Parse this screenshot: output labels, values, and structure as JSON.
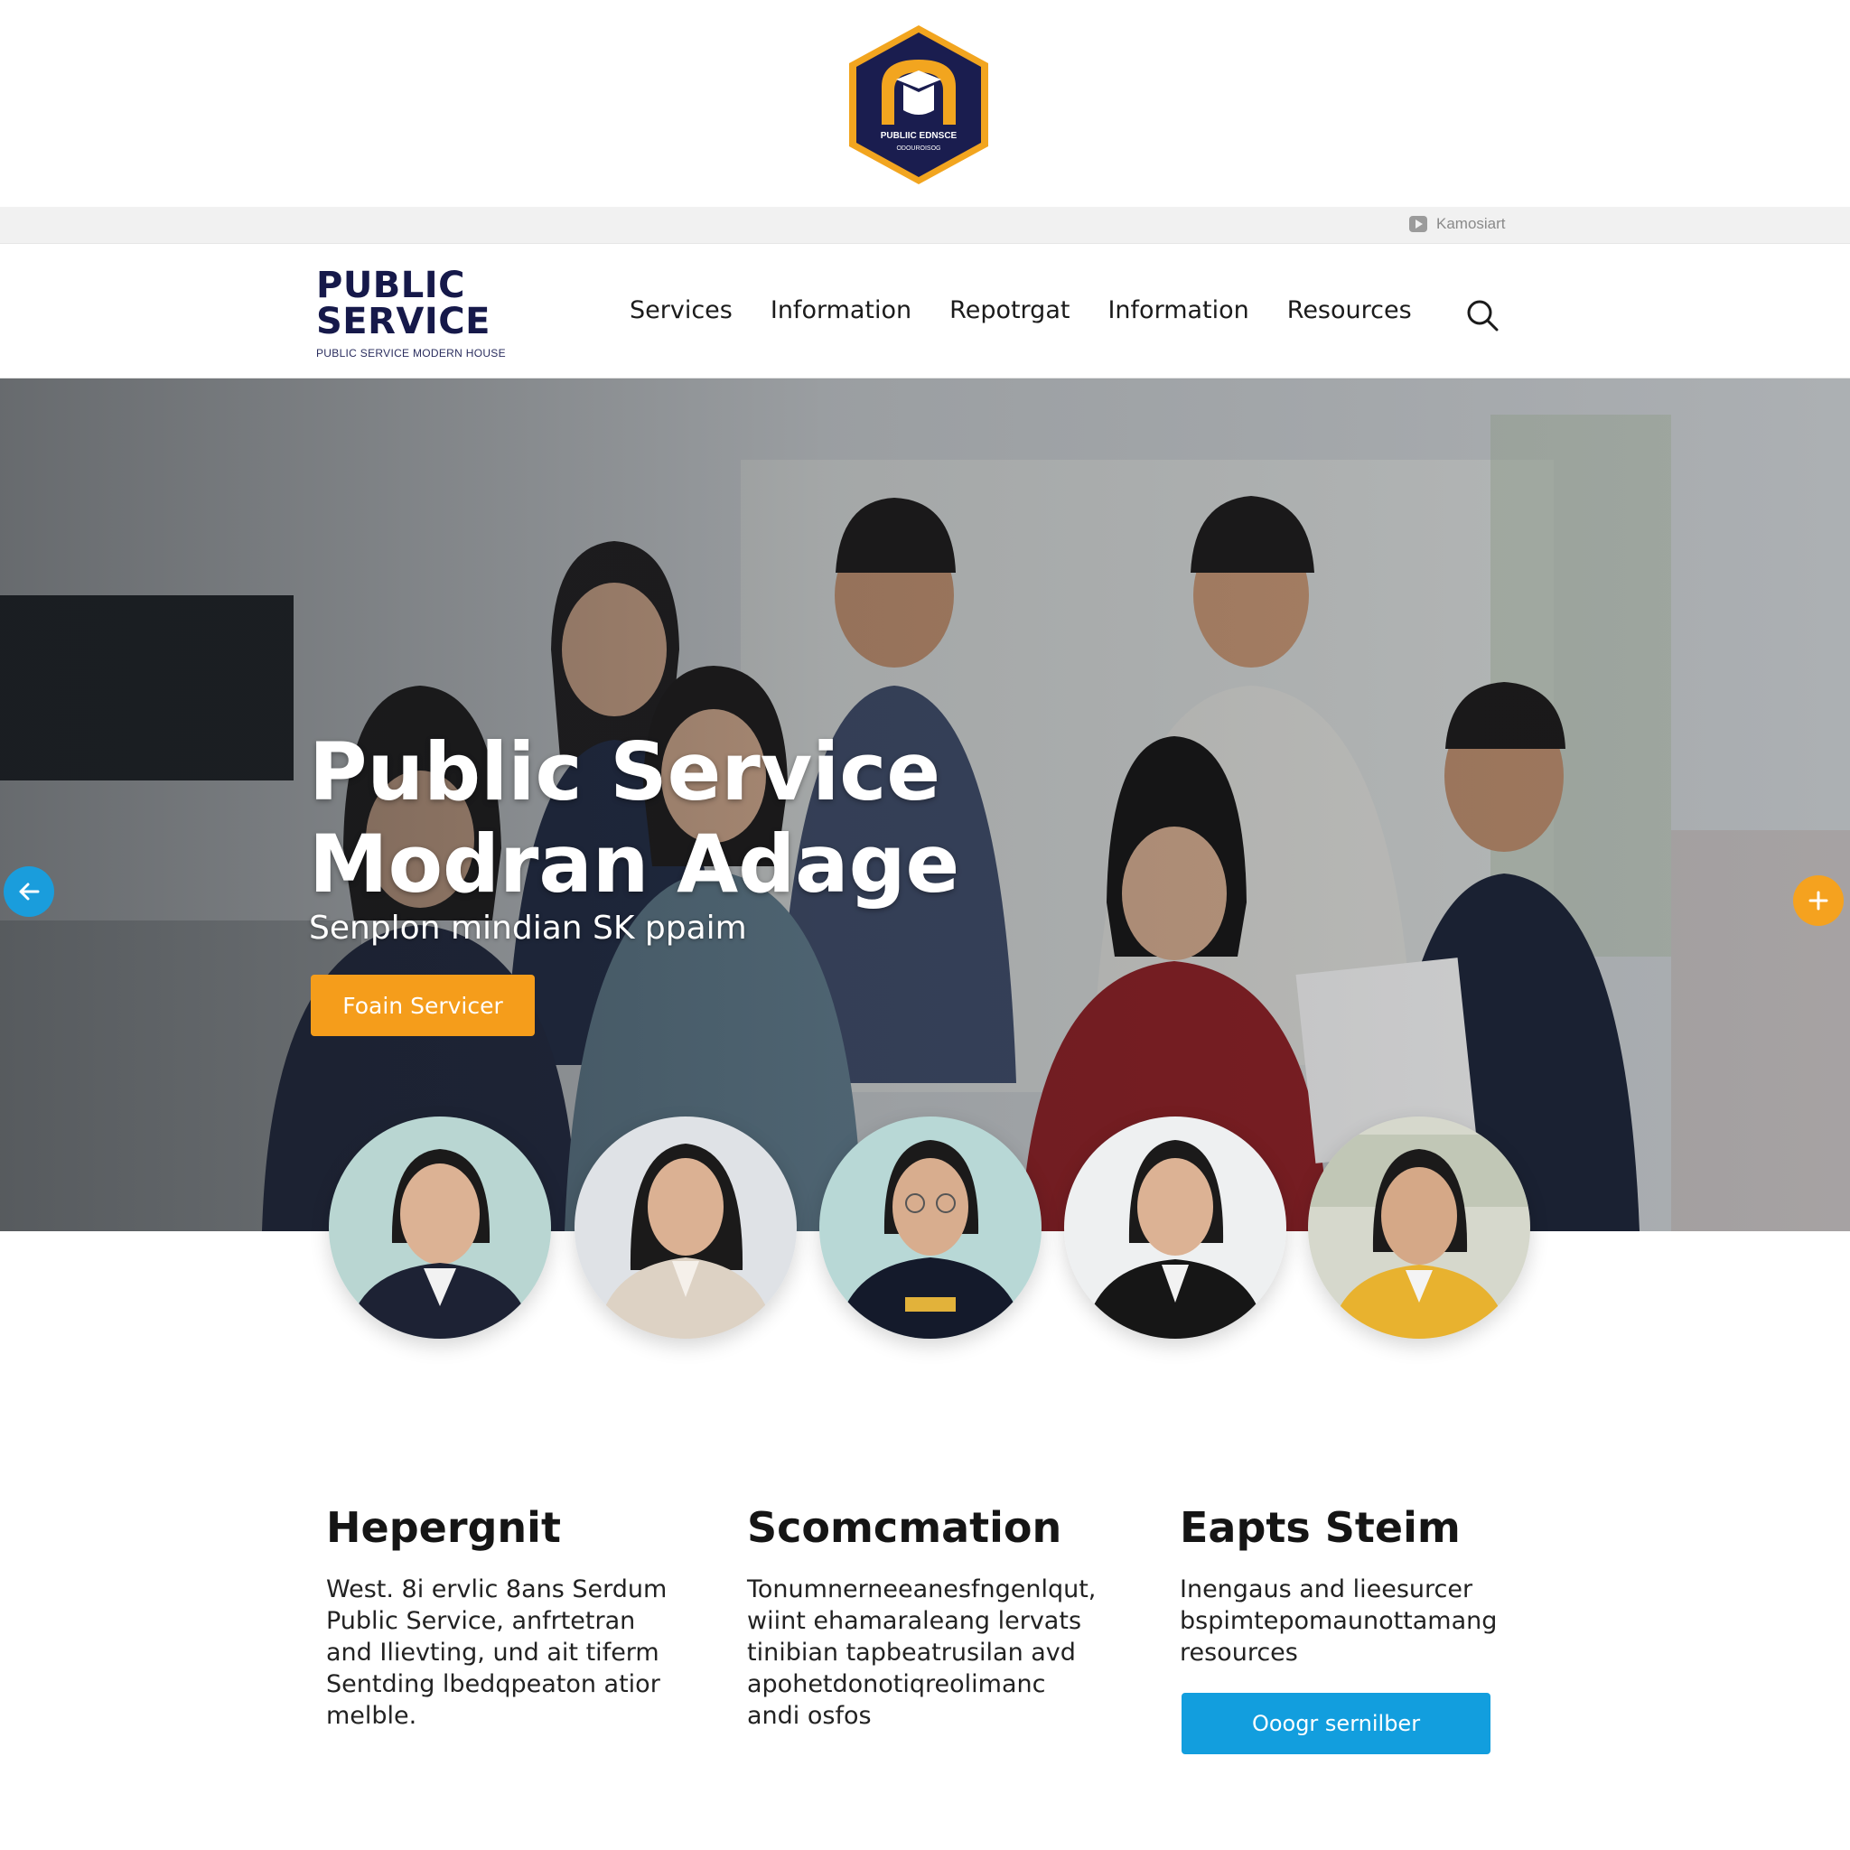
{
  "emblem": {
    "text_top": "PUBLIIC EDNSCE",
    "text_bottom": "ODOUROISOG"
  },
  "utility_bar": {
    "link_label": "Kamosiart"
  },
  "brand": {
    "line1": "PUBLIC",
    "line2": "SERVICE",
    "tagline": "PUBLIC SERVICE MODERN HOUSE"
  },
  "nav": {
    "items": [
      "Services",
      "Information",
      "Repotrgat",
      "Information",
      "Resources"
    ]
  },
  "hero": {
    "title_line1": "Public Service",
    "title_line2": "Modran Adage",
    "subtitle": "Senplon mindian SK ppaim",
    "cta_label": "Foain Servicer"
  },
  "features": [
    {
      "title": "Hepergnit",
      "lines": [
        "West. 8i ervlic 8ans Serdum",
        "Public Service, anfrtetran",
        "and Ilievting, und ait tiferm",
        "Sentding lbedqpeaton atior",
        "melble."
      ]
    },
    {
      "title": "Scomcmation",
      "lines": [
        "Tonumnerneeanesfngenlqut,",
        "wiint ehamaraleang lervats",
        "tinibian tapbeatrusilan avd",
        "apohetdonotiqreolimanc",
        "andi osfos"
      ]
    },
    {
      "title": "Eapts Steim",
      "lines": [
        "Inengaus and lieesurcer",
        "bspimtepomaunottamang",
        "resources"
      ],
      "button_label": "Ooogr sernilber"
    }
  ],
  "colors": {
    "navy": "#16194a",
    "orange": "#f59d1b",
    "blue": "#129ede",
    "emblem_gold": "#f2a51f"
  }
}
